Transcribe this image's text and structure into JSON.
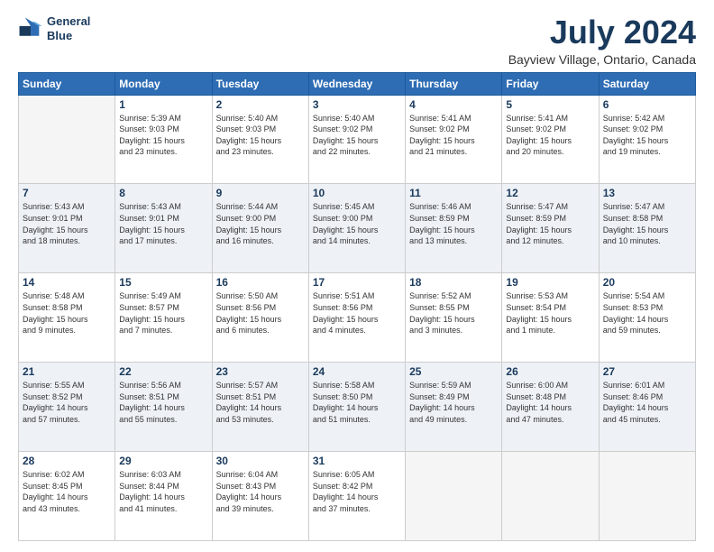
{
  "logo": {
    "line1": "General",
    "line2": "Blue"
  },
  "title": "July 2024",
  "subtitle": "Bayview Village, Ontario, Canada",
  "days": [
    "Sunday",
    "Monday",
    "Tuesday",
    "Wednesday",
    "Thursday",
    "Friday",
    "Saturday"
  ],
  "weeks": [
    [
      {
        "date": "",
        "info": ""
      },
      {
        "date": "1",
        "info": "Sunrise: 5:39 AM\nSunset: 9:03 PM\nDaylight: 15 hours\nand 23 minutes."
      },
      {
        "date": "2",
        "info": "Sunrise: 5:40 AM\nSunset: 9:03 PM\nDaylight: 15 hours\nand 23 minutes."
      },
      {
        "date": "3",
        "info": "Sunrise: 5:40 AM\nSunset: 9:02 PM\nDaylight: 15 hours\nand 22 minutes."
      },
      {
        "date": "4",
        "info": "Sunrise: 5:41 AM\nSunset: 9:02 PM\nDaylight: 15 hours\nand 21 minutes."
      },
      {
        "date": "5",
        "info": "Sunrise: 5:41 AM\nSunset: 9:02 PM\nDaylight: 15 hours\nand 20 minutes."
      },
      {
        "date": "6",
        "info": "Sunrise: 5:42 AM\nSunset: 9:02 PM\nDaylight: 15 hours\nand 19 minutes."
      }
    ],
    [
      {
        "date": "7",
        "info": "Sunrise: 5:43 AM\nSunset: 9:01 PM\nDaylight: 15 hours\nand 18 minutes."
      },
      {
        "date": "8",
        "info": "Sunrise: 5:43 AM\nSunset: 9:01 PM\nDaylight: 15 hours\nand 17 minutes."
      },
      {
        "date": "9",
        "info": "Sunrise: 5:44 AM\nSunset: 9:00 PM\nDaylight: 15 hours\nand 16 minutes."
      },
      {
        "date": "10",
        "info": "Sunrise: 5:45 AM\nSunset: 9:00 PM\nDaylight: 15 hours\nand 14 minutes."
      },
      {
        "date": "11",
        "info": "Sunrise: 5:46 AM\nSunset: 8:59 PM\nDaylight: 15 hours\nand 13 minutes."
      },
      {
        "date": "12",
        "info": "Sunrise: 5:47 AM\nSunset: 8:59 PM\nDaylight: 15 hours\nand 12 minutes."
      },
      {
        "date": "13",
        "info": "Sunrise: 5:47 AM\nSunset: 8:58 PM\nDaylight: 15 hours\nand 10 minutes."
      }
    ],
    [
      {
        "date": "14",
        "info": "Sunrise: 5:48 AM\nSunset: 8:58 PM\nDaylight: 15 hours\nand 9 minutes."
      },
      {
        "date": "15",
        "info": "Sunrise: 5:49 AM\nSunset: 8:57 PM\nDaylight: 15 hours\nand 7 minutes."
      },
      {
        "date": "16",
        "info": "Sunrise: 5:50 AM\nSunset: 8:56 PM\nDaylight: 15 hours\nand 6 minutes."
      },
      {
        "date": "17",
        "info": "Sunrise: 5:51 AM\nSunset: 8:56 PM\nDaylight: 15 hours\nand 4 minutes."
      },
      {
        "date": "18",
        "info": "Sunrise: 5:52 AM\nSunset: 8:55 PM\nDaylight: 15 hours\nand 3 minutes."
      },
      {
        "date": "19",
        "info": "Sunrise: 5:53 AM\nSunset: 8:54 PM\nDaylight: 15 hours\nand 1 minute."
      },
      {
        "date": "20",
        "info": "Sunrise: 5:54 AM\nSunset: 8:53 PM\nDaylight: 14 hours\nand 59 minutes."
      }
    ],
    [
      {
        "date": "21",
        "info": "Sunrise: 5:55 AM\nSunset: 8:52 PM\nDaylight: 14 hours\nand 57 minutes."
      },
      {
        "date": "22",
        "info": "Sunrise: 5:56 AM\nSunset: 8:51 PM\nDaylight: 14 hours\nand 55 minutes."
      },
      {
        "date": "23",
        "info": "Sunrise: 5:57 AM\nSunset: 8:51 PM\nDaylight: 14 hours\nand 53 minutes."
      },
      {
        "date": "24",
        "info": "Sunrise: 5:58 AM\nSunset: 8:50 PM\nDaylight: 14 hours\nand 51 minutes."
      },
      {
        "date": "25",
        "info": "Sunrise: 5:59 AM\nSunset: 8:49 PM\nDaylight: 14 hours\nand 49 minutes."
      },
      {
        "date": "26",
        "info": "Sunrise: 6:00 AM\nSunset: 8:48 PM\nDaylight: 14 hours\nand 47 minutes."
      },
      {
        "date": "27",
        "info": "Sunrise: 6:01 AM\nSunset: 8:46 PM\nDaylight: 14 hours\nand 45 minutes."
      }
    ],
    [
      {
        "date": "28",
        "info": "Sunrise: 6:02 AM\nSunset: 8:45 PM\nDaylight: 14 hours\nand 43 minutes."
      },
      {
        "date": "29",
        "info": "Sunrise: 6:03 AM\nSunset: 8:44 PM\nDaylight: 14 hours\nand 41 minutes."
      },
      {
        "date": "30",
        "info": "Sunrise: 6:04 AM\nSunset: 8:43 PM\nDaylight: 14 hours\nand 39 minutes."
      },
      {
        "date": "31",
        "info": "Sunrise: 6:05 AM\nSunset: 8:42 PM\nDaylight: 14 hours\nand 37 minutes."
      },
      {
        "date": "",
        "info": ""
      },
      {
        "date": "",
        "info": ""
      },
      {
        "date": "",
        "info": ""
      }
    ]
  ]
}
